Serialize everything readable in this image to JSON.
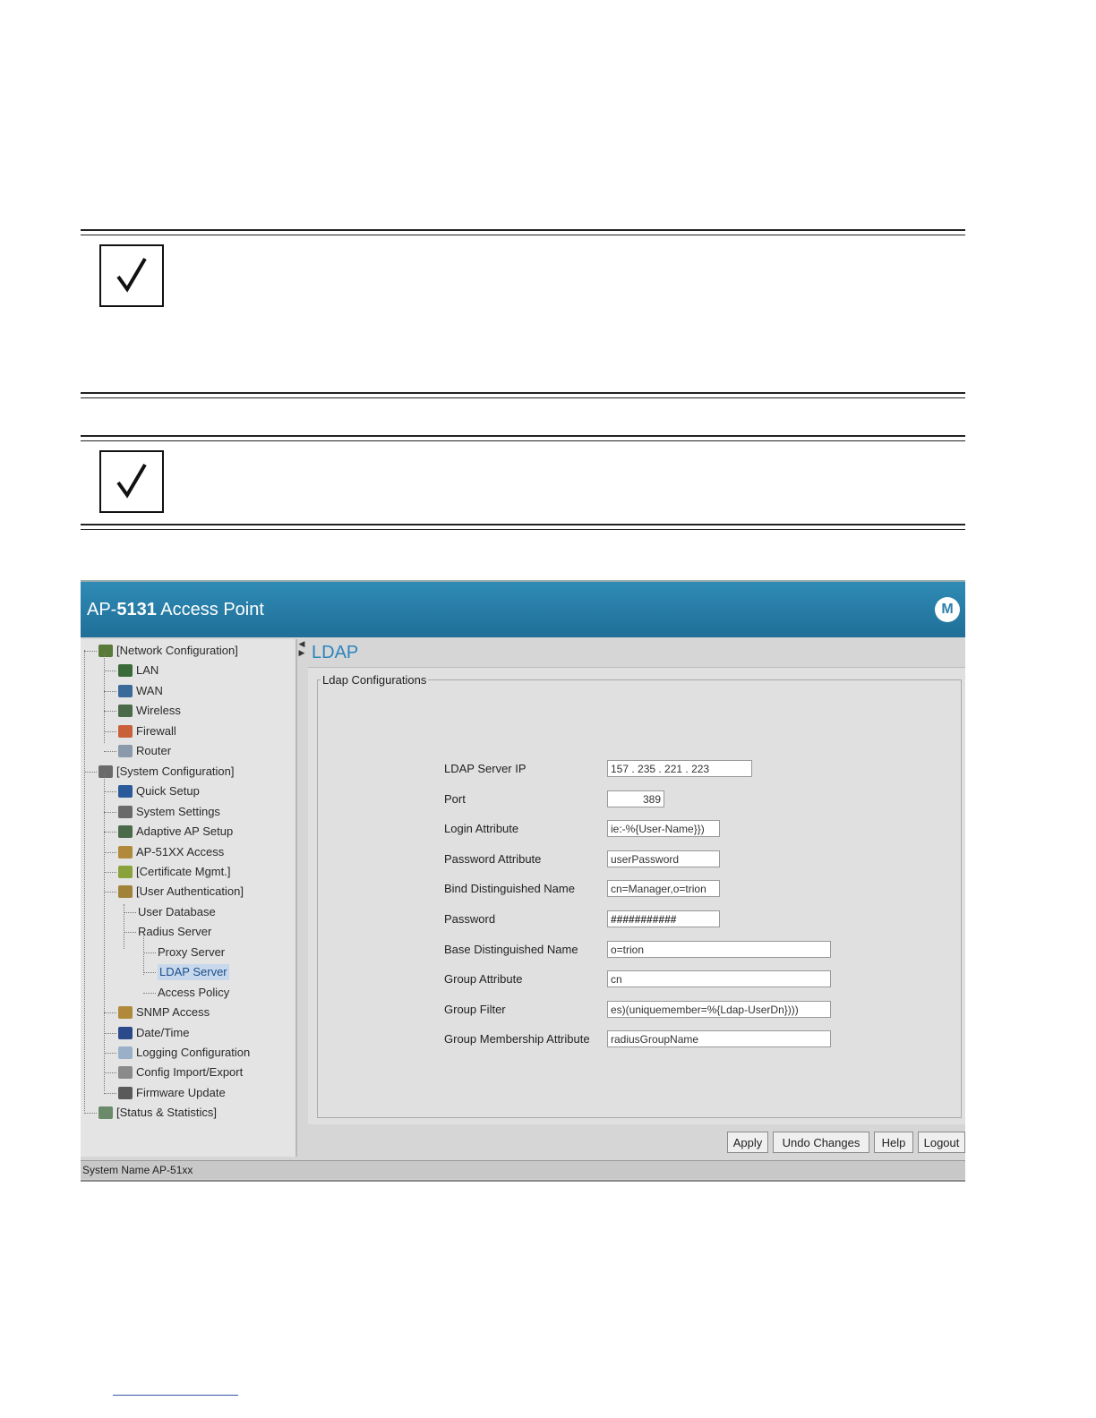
{
  "app": {
    "title_prefix": "AP-",
    "title_model": "5131",
    "title_suffix": " Access Point",
    "brand_glyph": "M",
    "accent_color": "#2a84bf"
  },
  "nav": {
    "items": [
      {
        "label": "[Network Configuration]",
        "icon": "network-icon"
      },
      {
        "label": "LAN",
        "icon": "lan-icon"
      },
      {
        "label": "WAN",
        "icon": "wan-icon"
      },
      {
        "label": "Wireless",
        "icon": "wireless-icon"
      },
      {
        "label": "Firewall",
        "icon": "firewall-icon"
      },
      {
        "label": "Router",
        "icon": "router-icon"
      },
      {
        "label": "[System Configuration]",
        "icon": "system-icon"
      },
      {
        "label": "Quick Setup",
        "icon": "quick-setup-icon"
      },
      {
        "label": "System Settings",
        "icon": "settings-icon"
      },
      {
        "label": "Adaptive AP Setup",
        "icon": "adaptive-ap-icon"
      },
      {
        "label": "AP-51XX Access",
        "icon": "access-icon"
      },
      {
        "label": "[Certificate Mgmt.]",
        "icon": "certificate-icon"
      },
      {
        "label": "[User Authentication]",
        "icon": "user-auth-icon"
      },
      {
        "label": "User Database",
        "icon": ""
      },
      {
        "label": "Radius Server",
        "icon": ""
      },
      {
        "label": "Proxy Server",
        "icon": ""
      },
      {
        "label": "LDAP Server",
        "icon": ""
      },
      {
        "label": "Access Policy",
        "icon": ""
      },
      {
        "label": "SNMP Access",
        "icon": "snmp-icon"
      },
      {
        "label": "Date/Time",
        "icon": "clock-icon"
      },
      {
        "label": "Logging Configuration",
        "icon": "logging-icon"
      },
      {
        "label": "Config Import/Export",
        "icon": "import-export-icon"
      },
      {
        "label": "Firmware Update",
        "icon": "firmware-icon"
      },
      {
        "label": "[Status & Statistics]",
        "icon": "statistics-icon"
      }
    ]
  },
  "main": {
    "title": "LDAP",
    "group_label": "Ldap Configurations",
    "fields": [
      {
        "label": "LDAP Server IP",
        "value": "157 . 235 . 221 . 223"
      },
      {
        "label": "Port",
        "value": "389"
      },
      {
        "label": "Login Attribute",
        "value": "ie:-%{User-Name}})"
      },
      {
        "label": "Password Attribute",
        "value": "userPassword"
      },
      {
        "label": "Bind Distinguished Name",
        "value": "cn=Manager,o=trion"
      },
      {
        "label": "Password",
        "value": "###########"
      },
      {
        "label": "Base Distinguished Name",
        "value": "o=trion"
      },
      {
        "label": "Group Attribute",
        "value": "cn"
      },
      {
        "label": "Group Filter",
        "value": "es)(uniquemember=%{Ldap-UserDn})))"
      },
      {
        "label": "Group Membership Attribute",
        "value": "radiusGroupName"
      }
    ]
  },
  "buttons": {
    "apply": "Apply",
    "undo": "Undo Changes",
    "help": "Help",
    "logout": "Logout"
  },
  "status": {
    "text": "System Name AP-51xx"
  }
}
